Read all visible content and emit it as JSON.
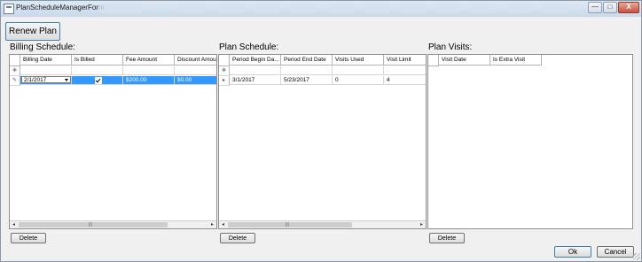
{
  "window": {
    "title": "PlanScheduleManagerForm",
    "controls": {
      "minimize": "—",
      "maximize": "□",
      "close": "X"
    }
  },
  "toolbar": {
    "renew_label": "Renew Plan"
  },
  "billing": {
    "label": "Billing Schedule:",
    "columns": [
      "Billing Date",
      "Is Billed",
      "Fee Amount",
      "Discount Amou"
    ],
    "rows": [
      {
        "billing_date": "2/1/2017",
        "is_billed": true,
        "fee_amount": "$200.00",
        "discount_amount": "$0.00"
      }
    ],
    "delete_label": "Delete"
  },
  "plan_schedule": {
    "label": "Plan Schedule:",
    "columns": [
      "Period Begin Da...",
      "Period End Date",
      "Visits Used",
      "Visit Limit"
    ],
    "rows": [
      {
        "period_begin": "3/1/2017",
        "period_end": "5/23/2017",
        "visits_used": "0",
        "visit_limit": "4"
      }
    ],
    "delete_label": "Delete"
  },
  "plan_visits": {
    "label": "Plan Visits:",
    "columns": [
      "Visit Date",
      "Is Extra Visit"
    ],
    "rows": [],
    "delete_label": "Delete"
  },
  "footer": {
    "ok_label": "Ok",
    "cancel_label": "Cancel"
  },
  "icons": {
    "new_row": "✱",
    "current_row": "✎",
    "current_row_arrow": "▸",
    "scroll_left": "◂",
    "scroll_right": "▸",
    "grip": "|||"
  },
  "colors": {
    "selection": "#3399ff",
    "title_bar": "#c9d8ea",
    "close": "#c9503c"
  }
}
